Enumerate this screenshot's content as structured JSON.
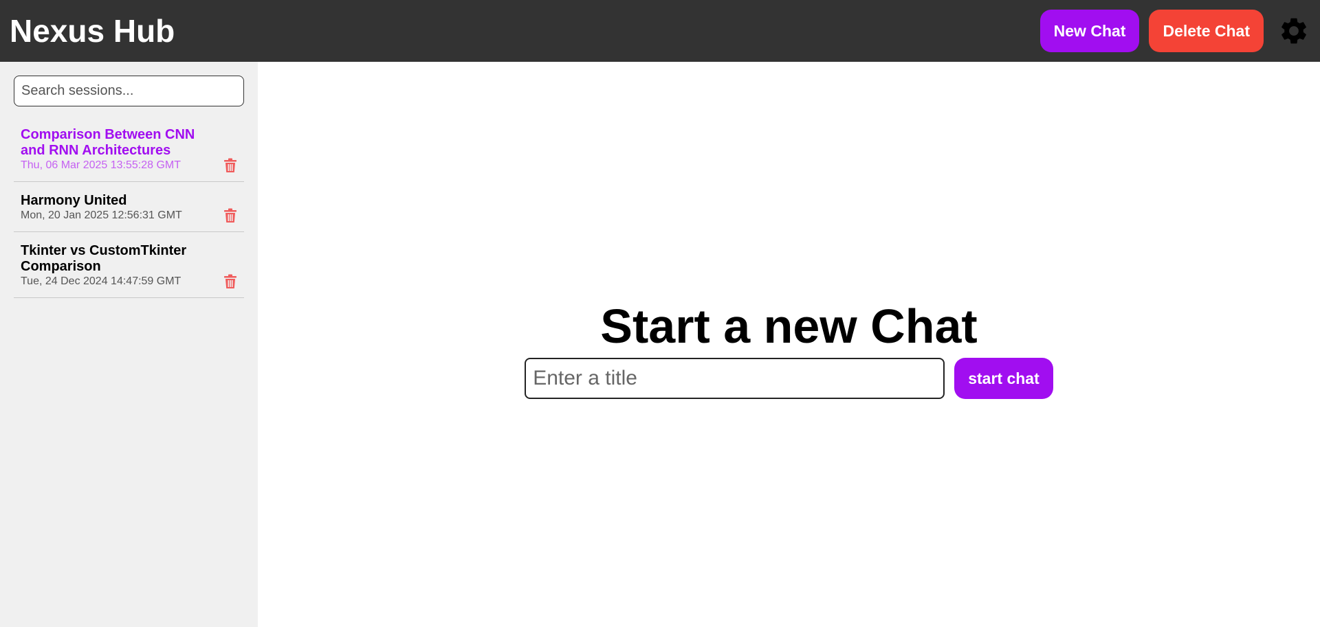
{
  "header": {
    "title": "Nexus Hub",
    "new_chat_label": "New Chat",
    "delete_chat_label": "Delete Chat",
    "settings_icon": "gear-icon"
  },
  "sidebar": {
    "search_placeholder": "Search sessions...",
    "sessions": [
      {
        "title": "Comparison Between CNN and RNN Architectures",
        "date": "Thu, 06 Mar 2025 13:55:28 GMT",
        "active": true
      },
      {
        "title": "Harmony United",
        "date": "Mon, 20 Jan 2025 12:56:31 GMT",
        "active": false
      },
      {
        "title": "Tkinter vs CustomTkinter Comparison",
        "date": "Tue, 24 Dec 2024 14:47:59 GMT",
        "active": false
      }
    ]
  },
  "main": {
    "heading": "Start a new Chat",
    "title_placeholder": "Enter a title",
    "start_label": "start chat"
  },
  "colors": {
    "accent": "#a10ef0",
    "danger": "#f44336",
    "header_bg": "#333333",
    "sidebar_bg": "#f0f0f0"
  }
}
